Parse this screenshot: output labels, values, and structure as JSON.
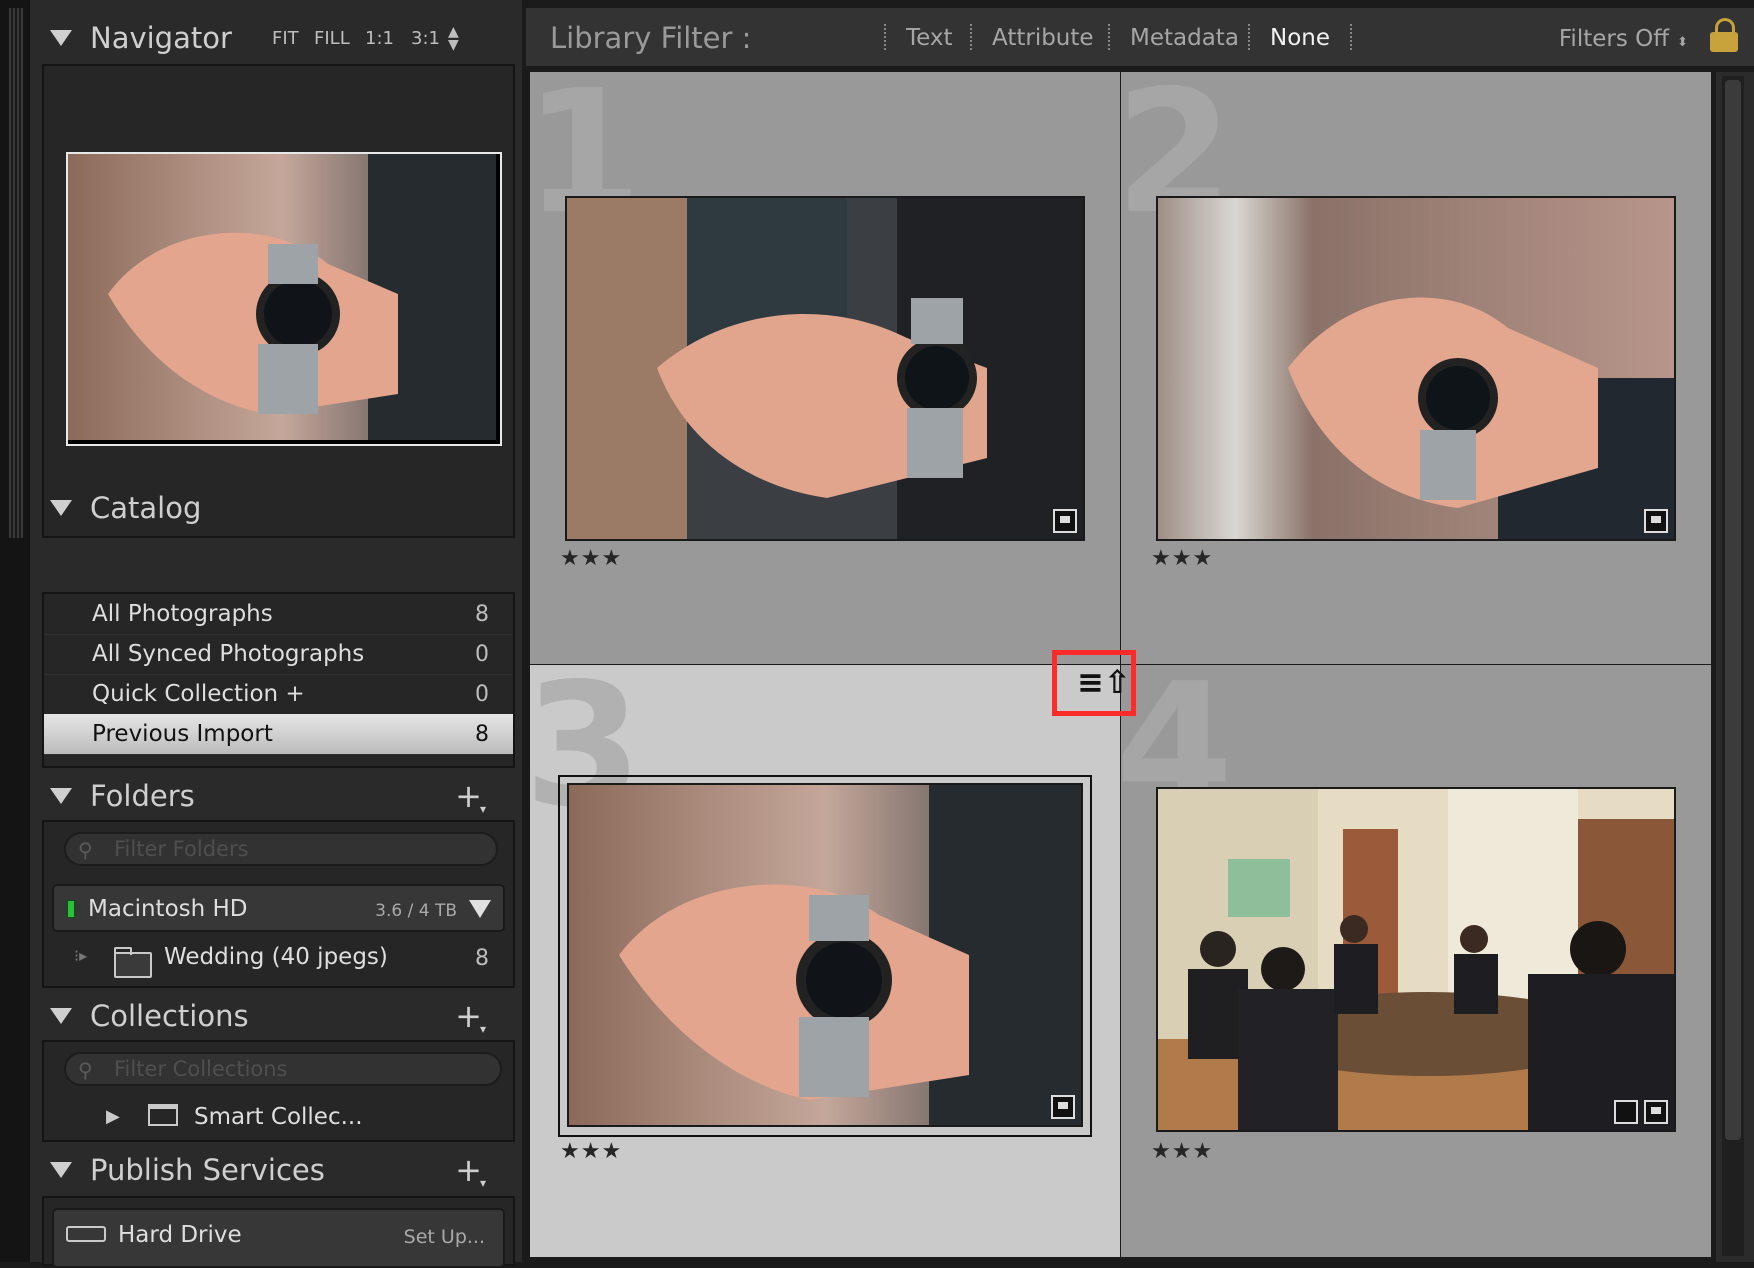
{
  "navigator": {
    "title": "Navigator",
    "zoom": [
      "FIT",
      "FILL",
      "1:1",
      "3:1"
    ]
  },
  "catalog": {
    "title": "Catalog",
    "items": [
      {
        "label": "All Photographs",
        "count": "8"
      },
      {
        "label": "All Synced Photographs",
        "count": "0"
      },
      {
        "label": "Quick Collection  +",
        "count": "0"
      },
      {
        "label": "Previous Import",
        "count": "8"
      }
    ]
  },
  "folders": {
    "title": "Folders",
    "filter_placeholder": "Filter Folders",
    "volume": {
      "label": "Macintosh HD",
      "capacity": "3.6 / 4 TB"
    },
    "folder": {
      "label": "Wedding (40 jpegs)",
      "count": "8"
    }
  },
  "collections": {
    "title": "Collections",
    "filter_placeholder": "Filter Collections",
    "item": {
      "label": "Smart Collec..."
    }
  },
  "publish": {
    "title": "Publish Services",
    "item": {
      "label": "Hard Drive",
      "action": "Set Up..."
    }
  },
  "filter_bar": {
    "title": "Library Filter :",
    "tabs": [
      "Text",
      "Attribute",
      "Metadata",
      "None"
    ],
    "active_tab": "None",
    "filters_off": "Filters Off"
  },
  "grid": {
    "cells": [
      {
        "number": "1",
        "stars": "★★★",
        "selected": false
      },
      {
        "number": "2",
        "stars": "★★★",
        "selected": false
      },
      {
        "number": "3",
        "stars": "★★★",
        "selected": true
      },
      {
        "number": "4",
        "stars": "★★★",
        "selected": false
      }
    ]
  },
  "colors": {
    "highlight": "#ff2a2a",
    "volume_led": "#2bc03a",
    "lock": "#c8a23a"
  }
}
